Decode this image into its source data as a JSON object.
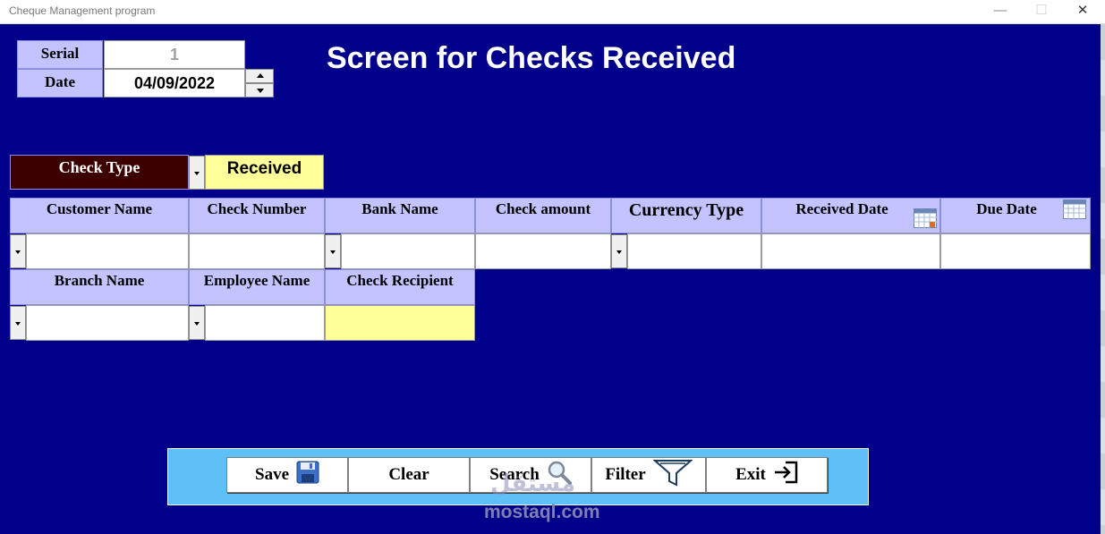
{
  "window": {
    "title": "Cheque Management program",
    "minimize_glyph": "—",
    "maximize_glyph": "☐",
    "close_glyph": "✕"
  },
  "header": {
    "serial_label": "Serial",
    "serial_value": "1",
    "date_label": "Date",
    "date_value": "04/09/2022",
    "heading": "Screen for Checks Received"
  },
  "check_type": {
    "label": "Check Type",
    "value": "Received"
  },
  "row1": {
    "customer_name": "Customer Name",
    "check_number": "Check Number",
    "bank_name": "Bank Name",
    "check_amount": "Check amount",
    "currency_type": "Currency Type",
    "received_date": "Received Date",
    "due_date": "Due Date"
  },
  "row2": {
    "branch_name": "Branch Name",
    "employee_name": "Employee Name",
    "check_recipient": "Check Recipient"
  },
  "toolbar": {
    "save": "Save",
    "clear": "Clear",
    "search": "Search",
    "filter": "Filter",
    "exit": "Exit"
  },
  "watermark": {
    "latin": "mostaql.com",
    "arabic": "مستقل"
  },
  "icons": [
    "calendar-icon",
    "floppy-disk-icon",
    "magnifier-icon",
    "funnel-icon",
    "exit-icon",
    "dropdown-arrow-icon"
  ],
  "colors": {
    "background": "#00008b",
    "label_bg": "#c3c3ff",
    "highlight_field": "#ffff99",
    "check_type_label_bg": "#3d0000",
    "toolbar_bg": "#5fc0f7"
  }
}
